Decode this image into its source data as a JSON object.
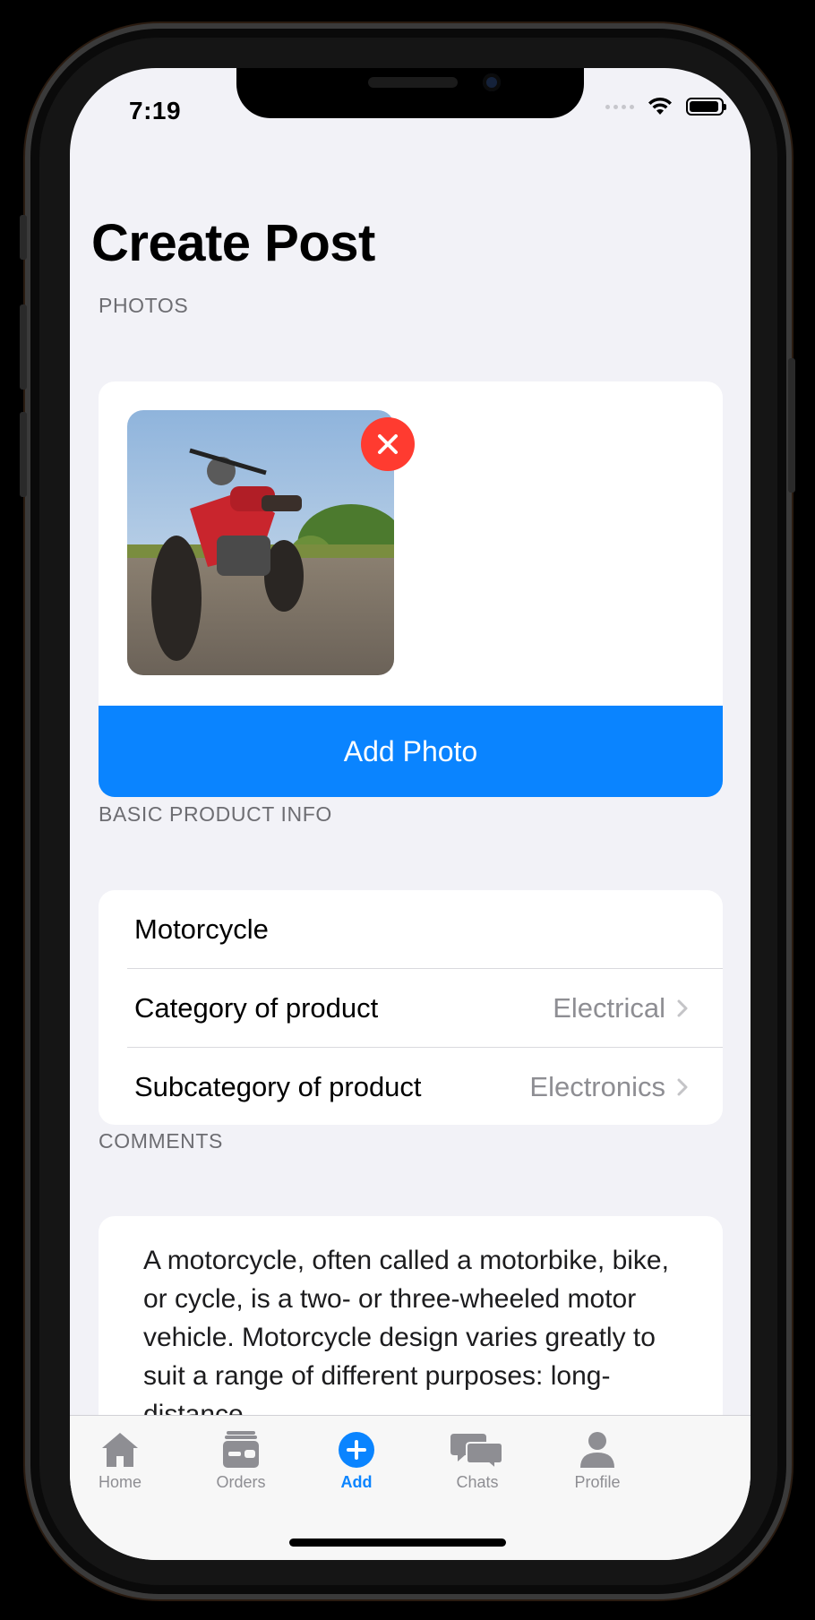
{
  "status_bar": {
    "time": "7:19"
  },
  "page": {
    "title": "Create Post"
  },
  "photos": {
    "header": "PHOTOS",
    "add_photo_label": "Add Photo"
  },
  "basic_info": {
    "header": "BASIC PRODUCT INFO",
    "product_name": "Motorcycle",
    "category": {
      "label": "Category of product",
      "value": "Electrical"
    },
    "subcategory": {
      "label": "Subcategory of product",
      "value": "Electronics"
    }
  },
  "comments": {
    "header": "COMMENTS",
    "text": "A motorcycle, often called a motorbike, bike, or cycle, is a two- or three-wheeled motor vehicle. Motorcycle design varies greatly to suit a range of different purposes: long-distance"
  },
  "tab_bar": {
    "items": [
      {
        "label": "Home",
        "icon": "house-icon"
      },
      {
        "label": "Orders",
        "icon": "wallet-icon"
      },
      {
        "label": "Add",
        "icon": "plus-circle-icon",
        "active": true
      },
      {
        "label": "Chats",
        "icon": "chat-bubbles-icon"
      },
      {
        "label": "Profile",
        "icon": "person-icon"
      }
    ]
  },
  "colors": {
    "accent": "#0a84ff",
    "destructive": "#ff3b30",
    "background": "#f2f2f7"
  }
}
